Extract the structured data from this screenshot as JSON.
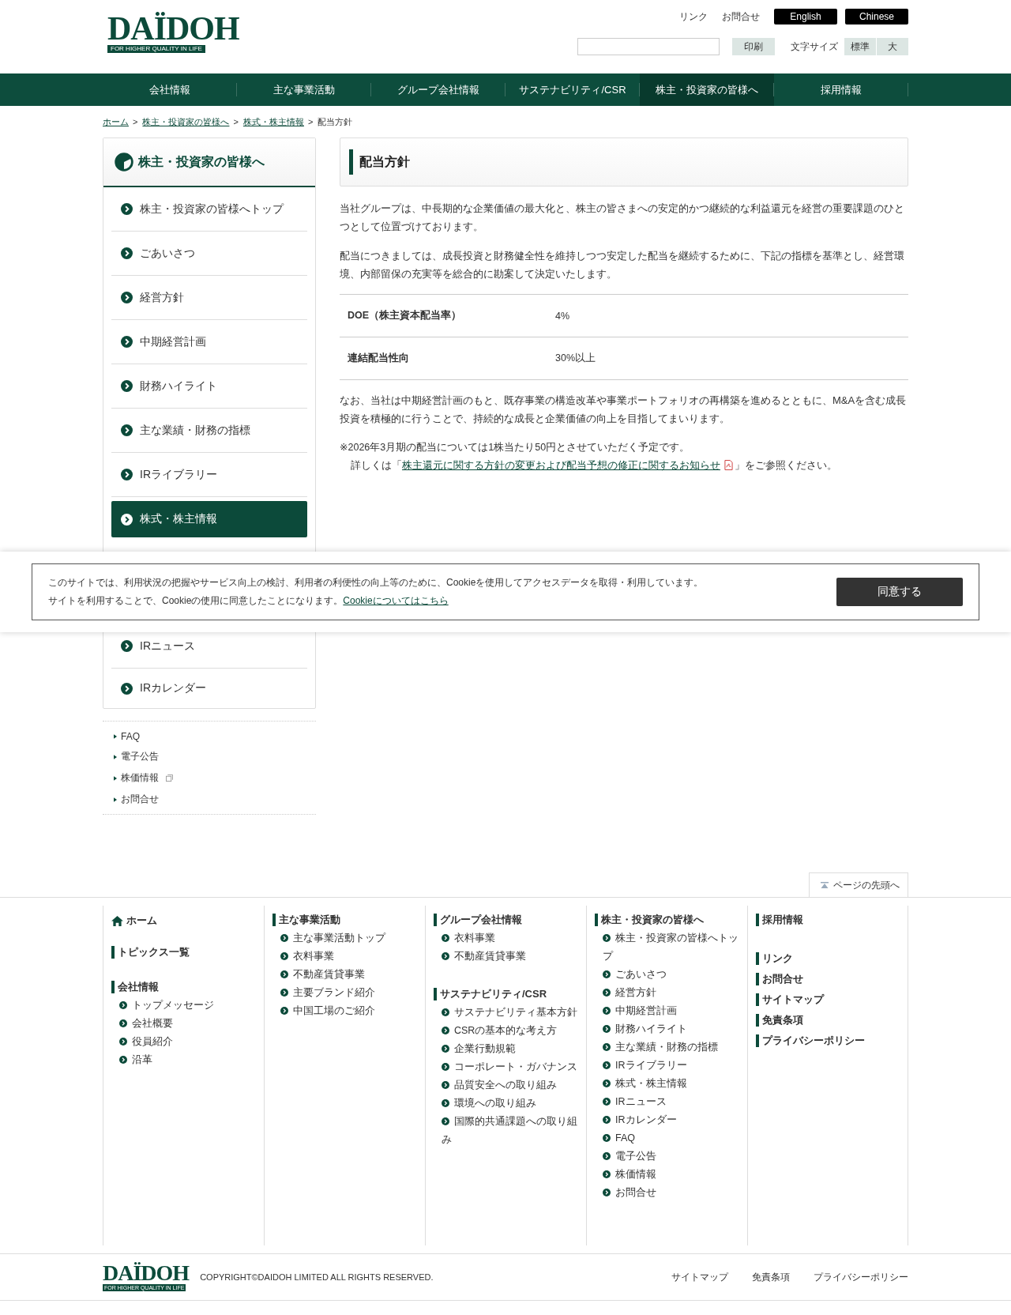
{
  "header": {
    "logo": {
      "name": "DAÏDOH",
      "tagline": "FOR HIGHER QUALITY IN LIFE"
    },
    "links": [
      "リンク",
      "お問合せ"
    ],
    "languages": [
      "English",
      "Chinese"
    ],
    "print_button": "印刷",
    "font_size": {
      "label": "文字サイズ",
      "options": [
        "標準",
        "大"
      ]
    }
  },
  "nav": [
    {
      "label": "会社情報",
      "selected": false
    },
    {
      "label": "主な事業活動",
      "selected": false
    },
    {
      "label": "グループ会社情報",
      "selected": false
    },
    {
      "label": "サステナビリティ/CSR",
      "selected": false
    },
    {
      "label": "株主・投資家の皆様へ",
      "selected": true
    },
    {
      "label": "採用情報",
      "selected": false
    }
  ],
  "breadcrumb": [
    {
      "label": "ホーム",
      "link": true,
      "separator": ">"
    },
    {
      "label": "株主・投資家の皆様へ",
      "link": true,
      "separator": ">"
    },
    {
      "label": "株式・株主情報",
      "link": true,
      "separator": ">"
    },
    {
      "label": "配当方針",
      "link": false
    }
  ],
  "sidebar": {
    "title": "株主・投資家の皆様へ",
    "items": [
      {
        "label": "株主・投資家の皆様へトップ",
        "selected": false
      },
      {
        "label": "ごあいさつ",
        "selected": false
      },
      {
        "label": "経営方針",
        "selected": false
      },
      {
        "label": "中期経営計画",
        "selected": false
      },
      {
        "label": "財務ハイライト",
        "selected": false
      },
      {
        "label": "主な業績・財務の指標",
        "selected": false
      },
      {
        "label": "IRライブラリー",
        "selected": false
      },
      {
        "label": "株式・株主情報",
        "selected": true
      }
    ],
    "items_below_banner": [
      {
        "label": "IRニュース",
        "selected": false
      },
      {
        "label": "IRカレンダー",
        "selected": false
      }
    ],
    "extra_links": [
      {
        "label": "FAQ",
        "external": false
      },
      {
        "label": "電子公告",
        "external": false
      },
      {
        "label": "株価情報",
        "external": true
      },
      {
        "label": "お問合せ",
        "external": false
      }
    ]
  },
  "main": {
    "title": "配当方針",
    "intro": [
      "当社グループは、中長期的な企業価値の最大化と、株主の皆さまへの安定的かつ継続的な利益還元を経営の重要課題のひとつとして位置づけております。",
      "配当につきましては、成長投資と財務健全性を維持しつつ安定した配当を継続するために、下記の指標を基準とし、経営環境、内部留保の充実等を総合的に勘案して決定いたします。"
    ],
    "table": [
      {
        "label": "DOE（株主資本配当率）",
        "value": "4%"
      },
      {
        "label": "連結配当性向",
        "value": "30%以上"
      }
    ],
    "outro": "なお、当社は中期経営計画のもと、既存事業の構造改革や事業ポートフォリオの再構築を進めるとともに、M&Aを含む成長投資を積極的に行うことで、持続的な成長と企業価値の向上を目指してまいります。",
    "note": "※2026年3月期の配当については1株当たり50円とさせていただく予定です。",
    "detail": {
      "before": "詳しくは「",
      "link": "株主還元に関する方針の変更および配当予想の修正に関するお知らせ",
      "after": "」をご参照ください。"
    }
  },
  "cookie_banner": {
    "lines": [
      "このサイトでは、利用状況の把握やサービス向上の検討、利用者の利便性の向上等のために、Cookieを使用してアクセスデータを取得・利用しています。",
      "サイトを利用することで、Cookieの使用に同意したことになります。"
    ],
    "link": "Cookieについてはこちら",
    "accept_button": "同意する"
  },
  "page_top": "ページの先頭へ",
  "footer": {
    "columns": [
      {
        "sections": [
          {
            "kind": "home",
            "title": "ホーム"
          },
          {
            "kind": "section",
            "title": "トピックス一覧"
          },
          {
            "kind": "section",
            "title": "会社情報",
            "items": [
              "トップメッセージ",
              "会社概要",
              "役員紹介",
              "沿革"
            ]
          }
        ]
      },
      {
        "sections": [
          {
            "kind": "section",
            "title": "主な事業活動",
            "items": [
              "主な事業活動トップ",
              "衣料事業",
              "不動産賃貸事業",
              "主要ブランド紹介",
              "中国工場のご紹介"
            ]
          }
        ]
      },
      {
        "sections": [
          {
            "kind": "section",
            "title": "グループ会社情報",
            "items": [
              "衣料事業",
              "不動産賃貸事業"
            ]
          },
          {
            "kind": "section",
            "title": "サステナビリティ/CSR",
            "items": [
              "サステナビリティ基本方針",
              "CSRの基本的な考え方",
              "企業行動規範",
              "コーポレート・ガバナンス",
              "品質安全への取り組み",
              "環境への取り組み",
              "国際的共通課題への取り組み"
            ]
          }
        ]
      },
      {
        "sections": [
          {
            "kind": "section",
            "title": "株主・投資家の皆様へ",
            "items": [
              "株主・投資家の皆様へトップ",
              "ごあいさつ",
              "経営方針",
              "中期経営計画",
              "財務ハイライト",
              "主な業績・財務の指標",
              "IRライブラリー",
              "株式・株主情報",
              "IRニュース",
              "IRカレンダー",
              "FAQ",
              "電子公告",
              "株価情報",
              "お問合せ"
            ]
          }
        ]
      },
      {
        "sections": [
          {
            "kind": "section",
            "title": "採用情報"
          },
          {
            "kind": "link",
            "title": "リンク"
          },
          {
            "kind": "link",
            "title": "お問合せ"
          },
          {
            "kind": "link",
            "title": "サイトマップ"
          },
          {
            "kind": "link",
            "title": "免責条項"
          },
          {
            "kind": "link",
            "title": "プライバシーポリシー"
          }
        ]
      }
    ]
  },
  "bottom_bar": {
    "logo": {
      "name": "DAÏDOH",
      "tagline": "FOR HIGHER QUALITY IN LIFE"
    },
    "copyright": "COPYRIGHT©DAIDOH LIMITED ALL RIGHTS RESERVED.",
    "links": [
      "サイトマップ",
      "免責条項",
      "プライバシーポリシー"
    ]
  }
}
